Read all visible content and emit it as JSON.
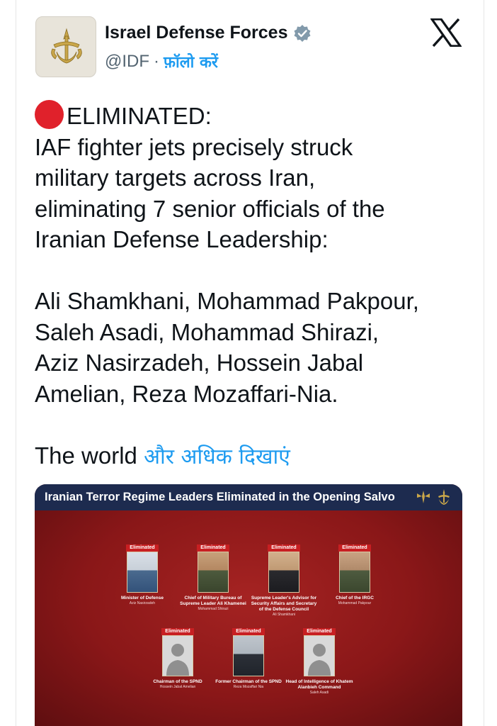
{
  "author": {
    "name": "Israel Defense Forces",
    "handle": "@IDF",
    "separator": "·",
    "follow_label": "फ़ॉलो करें"
  },
  "tweet": {
    "headline": "ELIMINATED:",
    "paragraph1": [
      "IAF fighter jets precisely struck",
      "military targets across Iran,",
      "eliminating 7 senior officials of the",
      "Iranian Defense Leadership:"
    ],
    "paragraph2": [
      "Ali Shamkhani, Mohammad Pakpour,",
      "Saleh Asadi, Mohammad Shirazi,",
      "Aziz Nasirzadeh, Hossein Jabal",
      "Amelian, Reza Mozaffari-Nia."
    ],
    "paragraph3_start": "The world",
    "show_more_label": "और अधिक दिखाएं"
  },
  "media": {
    "title": "Iranian Terror Regime Leaders Eliminated in the Opening Salvo",
    "tag_label": "Eliminated",
    "people": [
      {
        "role": "Minister of Defense",
        "name": "Aziz Nasirzadeh"
      },
      {
        "role": "Chief of Military Bureau of Supreme Leader Ali Khamenei",
        "name": "Mohammad Shirazi"
      },
      {
        "role": "Supreme Leader's Advisor for Security Affairs and Secretary of the Defense Council",
        "name": "Ali Shamkhani"
      },
      {
        "role": "Chief of the IRGC",
        "name": "Mohammad Pakpour"
      },
      {
        "role": "Chairman of the SPND",
        "name": "Hossein Jabal Amelian"
      },
      {
        "role": "Former Chairman of the SPND",
        "name": "Reza Mozaffari Nia"
      },
      {
        "role": "Head of Intelligence of Khatem Alanbieh Command",
        "name": "Saleh Asadi"
      }
    ]
  },
  "colors": {
    "link": "#1d9bf0",
    "red_circle": "#e0212b",
    "media_bar": "#1d2b4f",
    "media_bg": "#8e1a1b"
  },
  "icons": [
    "idf-emblem-icon",
    "verified-badge-icon",
    "x-logo-icon",
    "red-circle-icon"
  ]
}
